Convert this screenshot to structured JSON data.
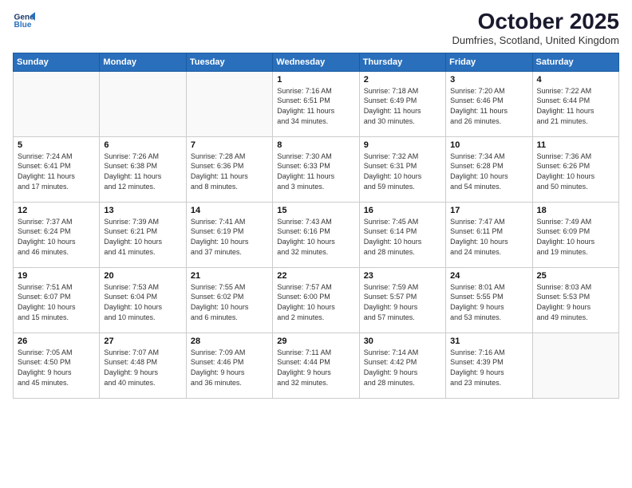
{
  "logo": {
    "line1": "General",
    "line2": "Blue"
  },
  "title": "October 2025",
  "location": "Dumfries, Scotland, United Kingdom",
  "weekdays": [
    "Sunday",
    "Monday",
    "Tuesday",
    "Wednesday",
    "Thursday",
    "Friday",
    "Saturday"
  ],
  "weeks": [
    [
      {
        "day": "",
        "info": ""
      },
      {
        "day": "",
        "info": ""
      },
      {
        "day": "",
        "info": ""
      },
      {
        "day": "1",
        "info": "Sunrise: 7:16 AM\nSunset: 6:51 PM\nDaylight: 11 hours\nand 34 minutes."
      },
      {
        "day": "2",
        "info": "Sunrise: 7:18 AM\nSunset: 6:49 PM\nDaylight: 11 hours\nand 30 minutes."
      },
      {
        "day": "3",
        "info": "Sunrise: 7:20 AM\nSunset: 6:46 PM\nDaylight: 11 hours\nand 26 minutes."
      },
      {
        "day": "4",
        "info": "Sunrise: 7:22 AM\nSunset: 6:44 PM\nDaylight: 11 hours\nand 21 minutes."
      }
    ],
    [
      {
        "day": "5",
        "info": "Sunrise: 7:24 AM\nSunset: 6:41 PM\nDaylight: 11 hours\nand 17 minutes."
      },
      {
        "day": "6",
        "info": "Sunrise: 7:26 AM\nSunset: 6:38 PM\nDaylight: 11 hours\nand 12 minutes."
      },
      {
        "day": "7",
        "info": "Sunrise: 7:28 AM\nSunset: 6:36 PM\nDaylight: 11 hours\nand 8 minutes."
      },
      {
        "day": "8",
        "info": "Sunrise: 7:30 AM\nSunset: 6:33 PM\nDaylight: 11 hours\nand 3 minutes."
      },
      {
        "day": "9",
        "info": "Sunrise: 7:32 AM\nSunset: 6:31 PM\nDaylight: 10 hours\nand 59 minutes."
      },
      {
        "day": "10",
        "info": "Sunrise: 7:34 AM\nSunset: 6:28 PM\nDaylight: 10 hours\nand 54 minutes."
      },
      {
        "day": "11",
        "info": "Sunrise: 7:36 AM\nSunset: 6:26 PM\nDaylight: 10 hours\nand 50 minutes."
      }
    ],
    [
      {
        "day": "12",
        "info": "Sunrise: 7:37 AM\nSunset: 6:24 PM\nDaylight: 10 hours\nand 46 minutes."
      },
      {
        "day": "13",
        "info": "Sunrise: 7:39 AM\nSunset: 6:21 PM\nDaylight: 10 hours\nand 41 minutes."
      },
      {
        "day": "14",
        "info": "Sunrise: 7:41 AM\nSunset: 6:19 PM\nDaylight: 10 hours\nand 37 minutes."
      },
      {
        "day": "15",
        "info": "Sunrise: 7:43 AM\nSunset: 6:16 PM\nDaylight: 10 hours\nand 32 minutes."
      },
      {
        "day": "16",
        "info": "Sunrise: 7:45 AM\nSunset: 6:14 PM\nDaylight: 10 hours\nand 28 minutes."
      },
      {
        "day": "17",
        "info": "Sunrise: 7:47 AM\nSunset: 6:11 PM\nDaylight: 10 hours\nand 24 minutes."
      },
      {
        "day": "18",
        "info": "Sunrise: 7:49 AM\nSunset: 6:09 PM\nDaylight: 10 hours\nand 19 minutes."
      }
    ],
    [
      {
        "day": "19",
        "info": "Sunrise: 7:51 AM\nSunset: 6:07 PM\nDaylight: 10 hours\nand 15 minutes."
      },
      {
        "day": "20",
        "info": "Sunrise: 7:53 AM\nSunset: 6:04 PM\nDaylight: 10 hours\nand 10 minutes."
      },
      {
        "day": "21",
        "info": "Sunrise: 7:55 AM\nSunset: 6:02 PM\nDaylight: 10 hours\nand 6 minutes."
      },
      {
        "day": "22",
        "info": "Sunrise: 7:57 AM\nSunset: 6:00 PM\nDaylight: 10 hours\nand 2 minutes."
      },
      {
        "day": "23",
        "info": "Sunrise: 7:59 AM\nSunset: 5:57 PM\nDaylight: 9 hours\nand 57 minutes."
      },
      {
        "day": "24",
        "info": "Sunrise: 8:01 AM\nSunset: 5:55 PM\nDaylight: 9 hours\nand 53 minutes."
      },
      {
        "day": "25",
        "info": "Sunrise: 8:03 AM\nSunset: 5:53 PM\nDaylight: 9 hours\nand 49 minutes."
      }
    ],
    [
      {
        "day": "26",
        "info": "Sunrise: 7:05 AM\nSunset: 4:50 PM\nDaylight: 9 hours\nand 45 minutes."
      },
      {
        "day": "27",
        "info": "Sunrise: 7:07 AM\nSunset: 4:48 PM\nDaylight: 9 hours\nand 40 minutes."
      },
      {
        "day": "28",
        "info": "Sunrise: 7:09 AM\nSunset: 4:46 PM\nDaylight: 9 hours\nand 36 minutes."
      },
      {
        "day": "29",
        "info": "Sunrise: 7:11 AM\nSunset: 4:44 PM\nDaylight: 9 hours\nand 32 minutes."
      },
      {
        "day": "30",
        "info": "Sunrise: 7:14 AM\nSunset: 4:42 PM\nDaylight: 9 hours\nand 28 minutes."
      },
      {
        "day": "31",
        "info": "Sunrise: 7:16 AM\nSunset: 4:39 PM\nDaylight: 9 hours\nand 23 minutes."
      },
      {
        "day": "",
        "info": ""
      }
    ]
  ]
}
